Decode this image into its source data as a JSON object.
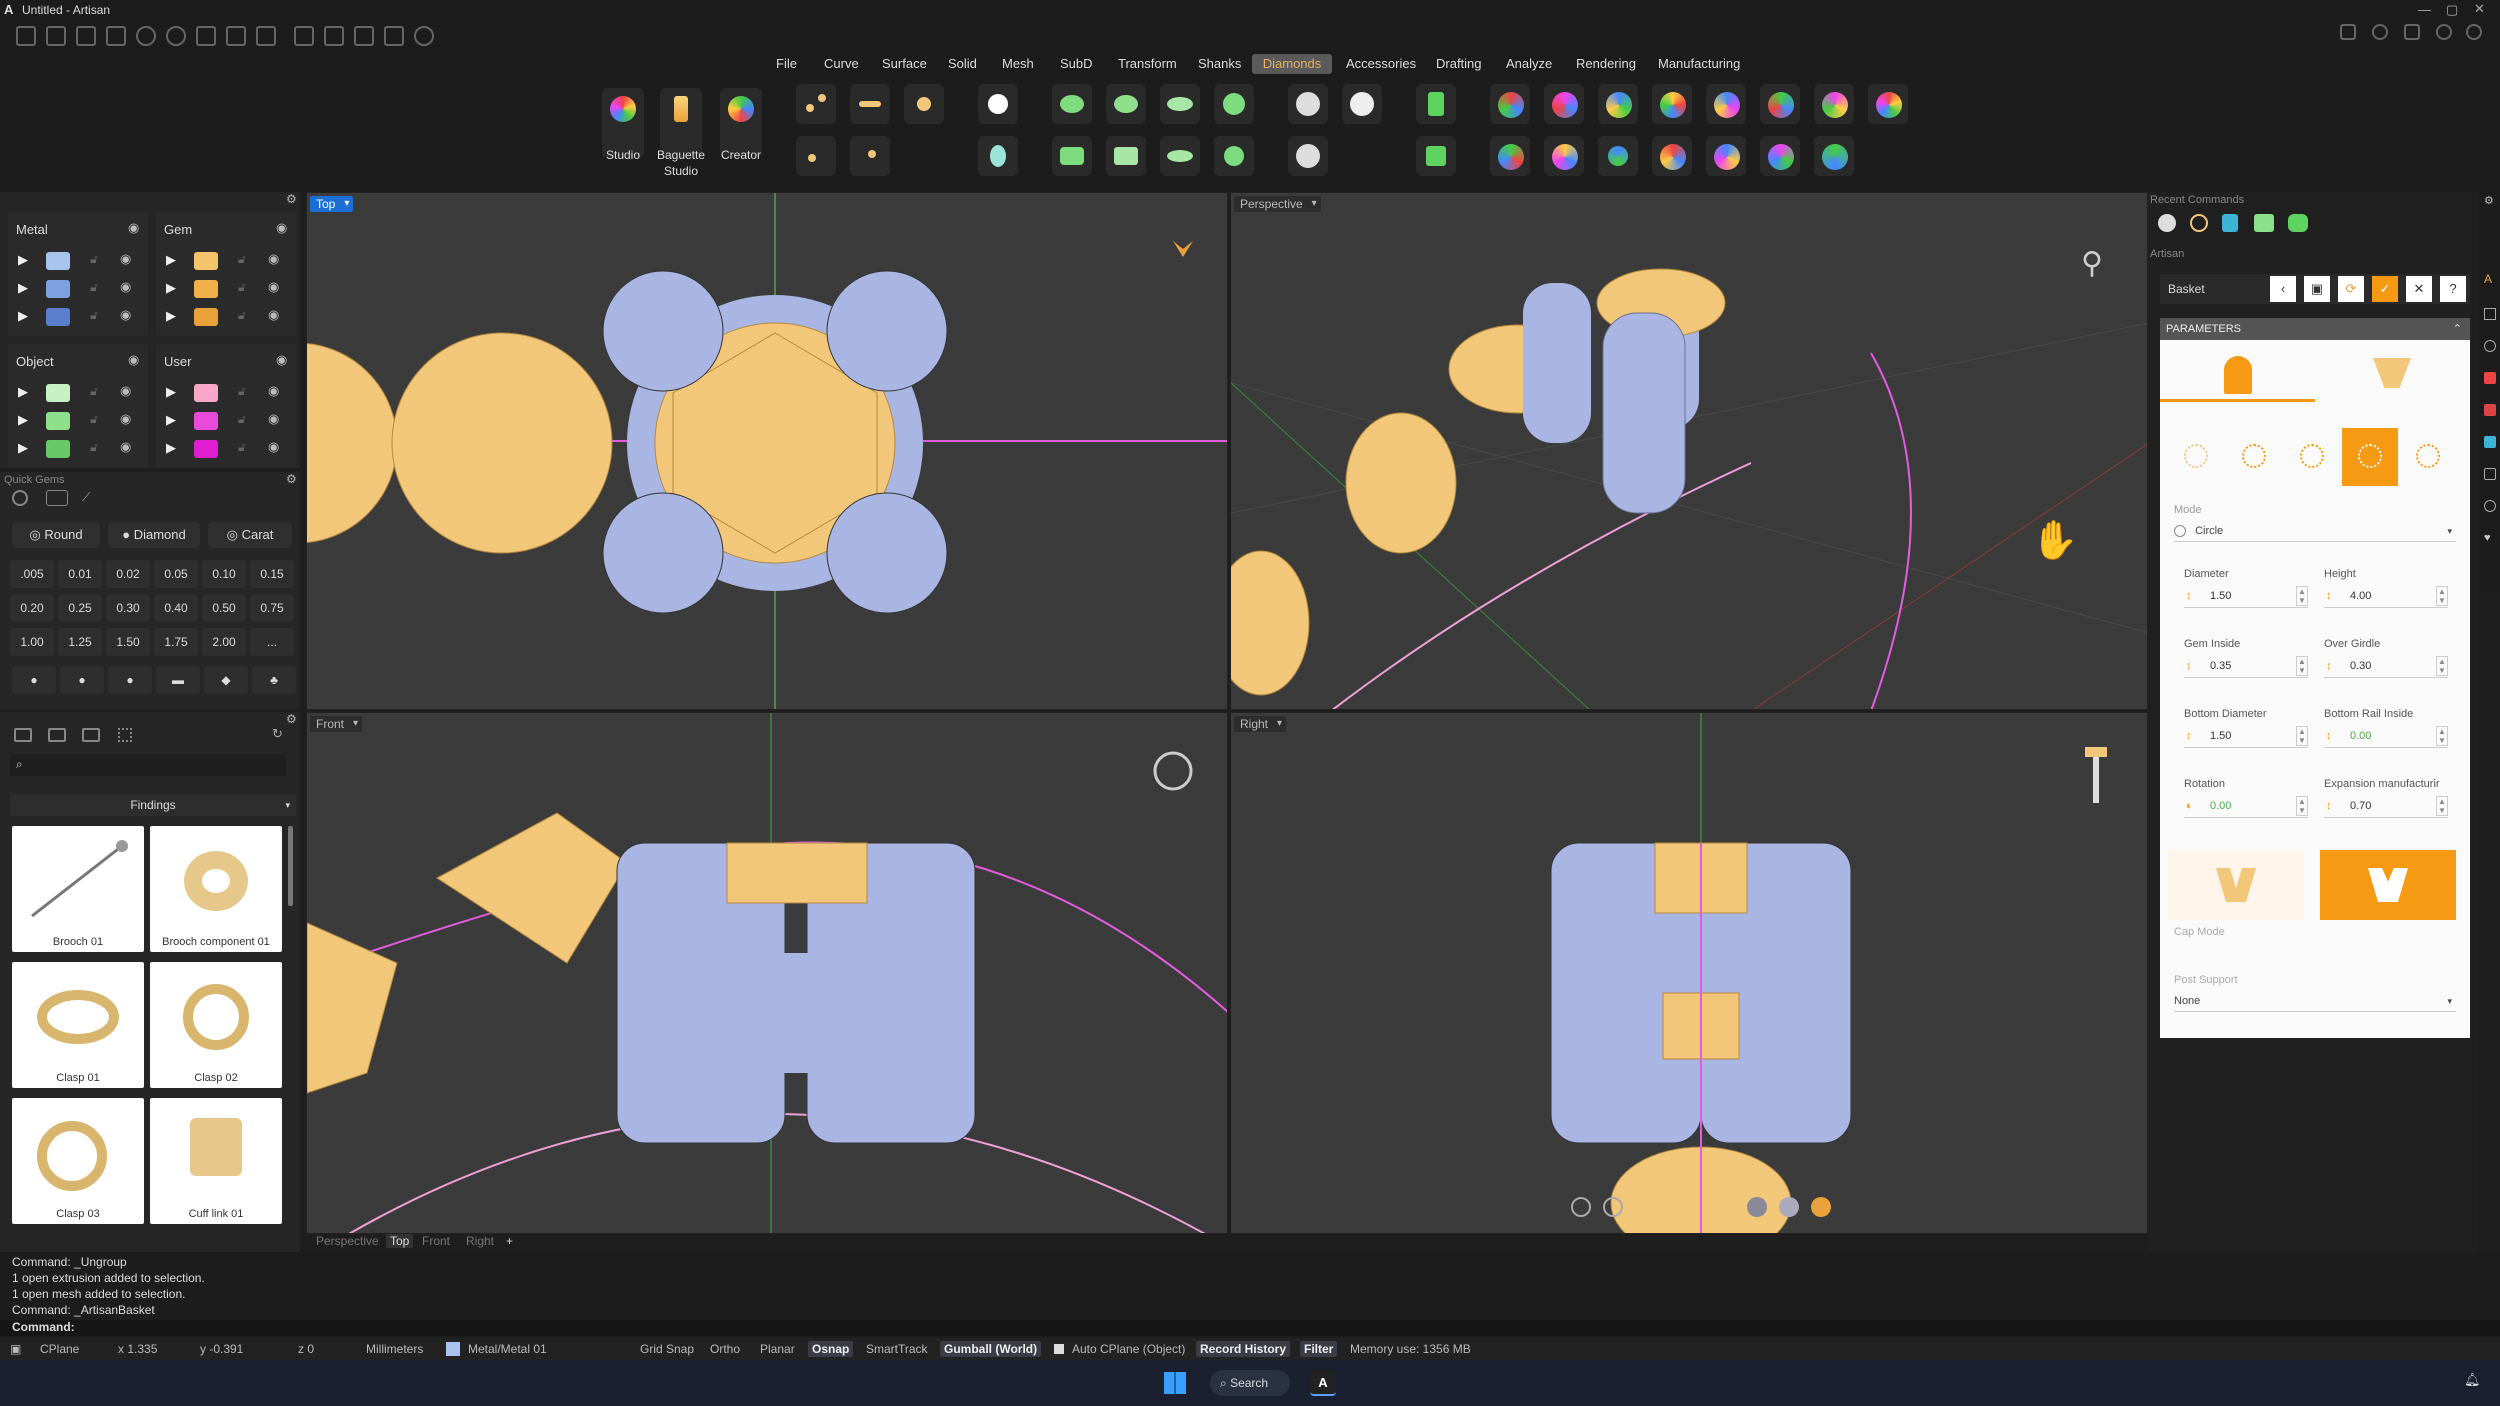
{
  "window": {
    "title": "Untitled - Artisan"
  },
  "menu": [
    "File",
    "Curve",
    "Surface",
    "Solid",
    "Mesh",
    "SubD",
    "Transform",
    "Shanks",
    "Diamonds",
    "Accessories",
    "Drafting",
    "Analyze",
    "Rendering",
    "Manufacturing"
  ],
  "menu_active": "Diamonds",
  "ribbon": {
    "studio": "Studio",
    "baguette_line1": "Baguette",
    "baguette_line2": "Studio",
    "creator": "Creator"
  },
  "layers": {
    "metal": "Metal",
    "gem": "Gem",
    "object": "Object",
    "user": "User",
    "metal_colors": [
      "#a9c3ef",
      "#7ea2df",
      "#5a7fcc"
    ],
    "gem_colors": [
      "#f5c36a",
      "#f0b04a",
      "#e9a13a"
    ],
    "object_colors": [
      "#c7f0c4",
      "#8fe08a",
      "#66c866"
    ],
    "user_colors": [
      "#f8a6c9",
      "#e84ad9",
      "#e020d0"
    ]
  },
  "quick_gems": {
    "title": "Quick Gems",
    "shape": "Round",
    "material": "Diamond",
    "unit": "Carat",
    "sizes": [
      ".005",
      "0.01",
      "0.02",
      "0.05",
      "0.10",
      "0.15",
      "0.20",
      "0.25",
      "0.30",
      "0.40",
      "0.50",
      "0.75",
      "1.00",
      "1.25",
      "1.50",
      "1.75",
      "2.00",
      "..."
    ]
  },
  "library": {
    "search_placeholder": "",
    "category": "Findings",
    "items": [
      "Brooch 01",
      "Brooch component 01",
      "Clasp 01",
      "Clasp 02",
      "Clasp 03",
      "Cuff link 01"
    ]
  },
  "viewports": {
    "top": "Top",
    "perspective": "Perspective",
    "front": "Front",
    "right": "Right"
  },
  "viewport_tabs": [
    "Perspective",
    "Top",
    "Front",
    "Right"
  ],
  "viewport_tab_active": "Top",
  "recent": {
    "title": "Recent Commands",
    "artisan": "Artisan",
    "basket": "Basket"
  },
  "params": {
    "header": "PARAMETERS",
    "mode_label": "Mode",
    "mode_value": "Circle",
    "diameter_label": "Diameter",
    "diameter": "1.50",
    "height_label": "Height",
    "height": "4.00",
    "gem_inside_label": "Gem Inside",
    "gem_inside": "0.35",
    "over_girdle_label": "Over Girdle",
    "over_girdle": "0.30",
    "bottom_diameter_label": "Bottom Diameter",
    "bottom_diameter": "1.50",
    "bottom_rail_label": "Bottom Rail Inside",
    "bottom_rail": "0.00",
    "rotation_label": "Rotation",
    "rotation": "0.00",
    "expansion_label": "Expansion manufacturir",
    "expansion": "0.70",
    "cap_mode_label": "Cap Mode",
    "post_support_label": "Post Support",
    "post_support_value": "None"
  },
  "command_history": [
    "Command: _Ungroup",
    "1 open extrusion added to selection.",
    "1 open mesh added to selection.",
    "Command: _ArtisanBasket"
  ],
  "command_prompt": "Command:",
  "status": {
    "cplane": "CPlane",
    "x": "x 1.335",
    "y": "y -0.391",
    "z": "z 0",
    "units": "Millimeters",
    "layer": "Metal/Metal 01",
    "grid_snap": "Grid Snap",
    "ortho": "Ortho",
    "planar": "Planar",
    "osnap": "Osnap",
    "smarttrack": "SmartTrack",
    "gumball": "Gumball (World)",
    "auto_cplane": "Auto CPlane (Object)",
    "record_history": "Record History",
    "filter": "Filter",
    "memory": "Memory use: 1356 MB"
  },
  "taskbar": {
    "search": "Search"
  },
  "colors": {
    "accent": "#f59a12",
    "gold": "#f2c77a",
    "metal": "#a9b5e2",
    "viewport_bg": "#3b3b3b",
    "active_blue": "#1b6fd4"
  }
}
